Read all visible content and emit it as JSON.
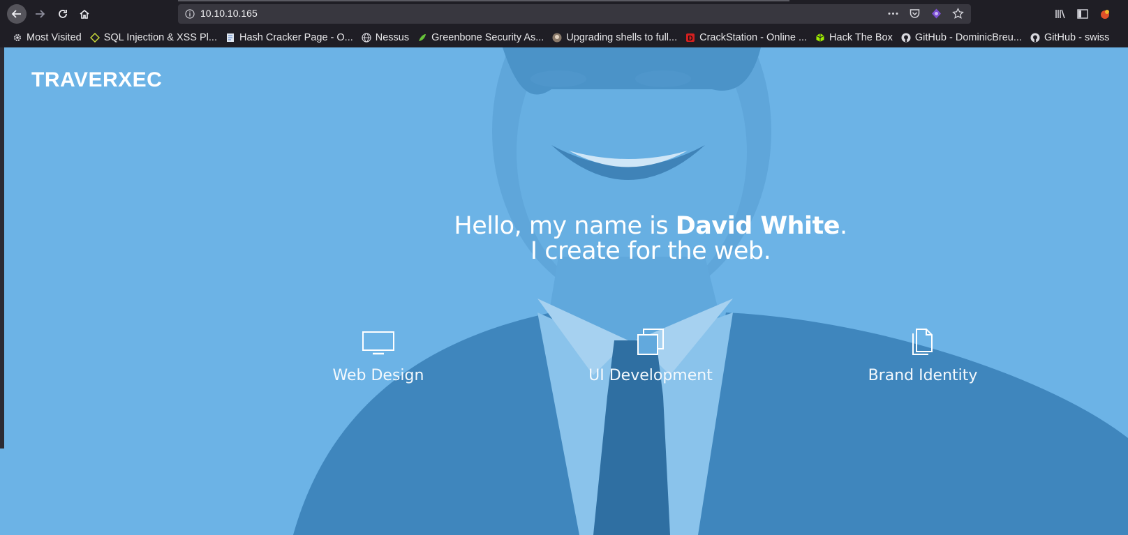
{
  "browser": {
    "url": "10.10.10.165",
    "bookmarks": [
      {
        "label": "Most Visited",
        "icon": "gear-icon"
      },
      {
        "label": "SQL Injection & XSS Pl...",
        "icon": "diamond-icon"
      },
      {
        "label": "Hash Cracker Page - O...",
        "icon": "document-icon"
      },
      {
        "label": "Nessus",
        "icon": "globe-icon"
      },
      {
        "label": "Greenbone Security As...",
        "icon": "greenbone-icon"
      },
      {
        "label": "Upgrading shells to full...",
        "icon": "avatar-icon"
      },
      {
        "label": "CrackStation - Online ...",
        "icon": "crackstation-icon"
      },
      {
        "label": "Hack The Box",
        "icon": "cube-icon"
      },
      {
        "label": "GitHub - DominicBreu...",
        "icon": "github-icon"
      },
      {
        "label": "GitHub - swiss",
        "icon": "github-icon"
      }
    ]
  },
  "site": {
    "brand": "TRAVERXEC",
    "hero": {
      "greeting": "Hello, my name is ",
      "name": "David White",
      "period": ".",
      "tagline": "I create for the web."
    },
    "services": [
      {
        "label": "Web Design",
        "icon": "monitor-icon"
      },
      {
        "label": "UI Development",
        "icon": "windows-stack-icon"
      },
      {
        "label": "Brand Identity",
        "icon": "documents-icon"
      }
    ]
  },
  "colors": {
    "page_bg": "#6cb3e6",
    "chrome_bg": "#1f1e25",
    "urlbar_bg": "#38373f"
  }
}
